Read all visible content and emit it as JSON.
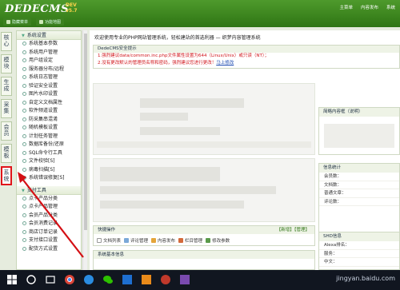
{
  "app": {
    "logo": "DEDECMS",
    "version_line1": "DEV",
    "version_line2": "v5.7"
  },
  "shortcuts": [
    "隐藏菜单",
    "功能地图"
  ],
  "topnav": [
    "主菜单",
    "内容发布",
    "系统"
  ],
  "left_tabs": [
    "核心",
    "模块",
    "生成",
    "采集",
    "会员",
    "模板",
    "系统"
  ],
  "menu": {
    "section1": "系统设置",
    "items1": [
      "系统基本参数",
      "系统用户管理",
      "用户组设定",
      "服务器分布/远程",
      "系统日志管理",
      "验证安全设置",
      "图片水印设置",
      "自定义文档属性",
      "软件频道设置",
      "防采集串混淆",
      "随机模板设置",
      "计划任务管理",
      "数据库备份/还原",
      "SQL命令行工具",
      "文件校验[S]",
      "病毒扫描[S]",
      "系统错误修复[S]"
    ],
    "section2": "支付工具",
    "items2": [
      "点卡产品分类",
      "点卡产品管理",
      "会员产品分类",
      "会员消费记录",
      "商店订单记录",
      "支付接口设置",
      "配货方式设置"
    ]
  },
  "main": {
    "welcome": "欢迎使用专业的PHP网站管理系统，轻松建站的首选利器 — 织梦内容管理系统",
    "alert_title": "DedeCMS安全提示",
    "alert1": "1.强烈建议data/common.inc.php文件属性设置为644（Linux/Unix）或只读（NT）；",
    "alert2": "2.没有更改默认的管理员名称和密码，强烈建议您进行更改！",
    "alert2_link": "马上修改",
    "side1_title": "简略内容框（说明）",
    "side2_title": "信息统计",
    "stats": [
      "会员数：",
      "文档数：",
      "普通文章：",
      "评论数："
    ],
    "side3_title": "SHD信息",
    "sd_rows": [
      "Alexa排名：",
      "服务：",
      "中文："
    ],
    "quick_title": "快捷操作",
    "quick_link": "【新增】【管理】",
    "quick_items": [
      "文档列表",
      "评论管理",
      "内容发布",
      "栏目管理",
      "修改参数"
    ],
    "sysinfo_title": "系统基本信息"
  },
  "watermark": "jingyan.baidu.com",
  "colors": {
    "topbar": "#3a8420",
    "alert": "#d0141a",
    "link": "#1a49b0",
    "highlight": "#e0141a"
  }
}
